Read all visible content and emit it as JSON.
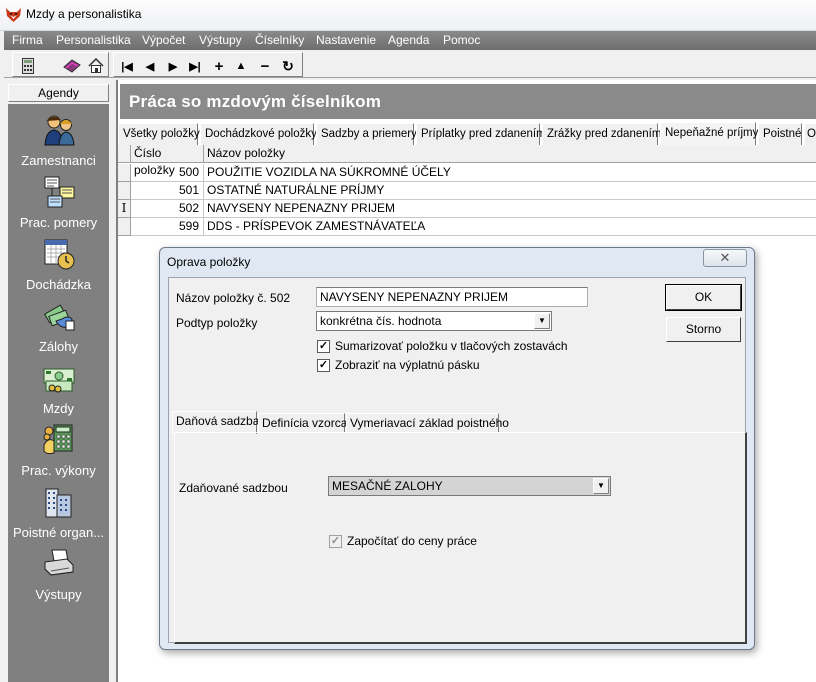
{
  "window": {
    "title": "Mzdy a personalistika",
    "icon": "fox-app-icon"
  },
  "menu": [
    "Firma",
    "Personalistika",
    "Výpočet",
    "Výstupy",
    "Číselníky",
    "Nastavenie",
    "Agenda",
    "Pomoc"
  ],
  "toolbar": {
    "icons": [
      "calculator-icon",
      "book-icon",
      "home-icon",
      "first-record-icon",
      "previous-record-icon",
      "next-record-icon",
      "last-record-icon",
      "add-record-icon",
      "up-icon",
      "delete-record-icon",
      "refresh-icon"
    ]
  },
  "agendy": {
    "header": "Agendy",
    "items": [
      {
        "label": "Zamestnanci",
        "icon": "employees-icon"
      },
      {
        "label": "Prac. pomery",
        "icon": "work-relations-icon"
      },
      {
        "label": "Dochádzka",
        "icon": "attendance-icon"
      },
      {
        "label": "Zálohy",
        "icon": "advances-icon"
      },
      {
        "label": "Mzdy",
        "icon": "wages-icon"
      },
      {
        "label": "Prac. výkony",
        "icon": "work-output-icon"
      },
      {
        "label": "Poistné organ...",
        "icon": "insurance-org-icon"
      },
      {
        "label": "Výstupy",
        "icon": "printer-icon"
      }
    ]
  },
  "page": {
    "title": "Práca so mzdovým číselníkom",
    "tabs": [
      "Všetky položky",
      "Dochádzkové položky",
      "Sadzby a priemery",
      "Príplatky pred zdanením",
      "Zrážky pred zdanením",
      "Nepeňažné príjmy",
      "Poistné",
      "O"
    ],
    "active_tab": "Nepeňažné príjmy",
    "table": {
      "columns": [
        "Číslo položky",
        "Názov položky"
      ],
      "rows": [
        {
          "indicator": "",
          "number": "500",
          "name": "POUŽITIE VOZIDLA NA SÚKROMNÉ ÚČELY"
        },
        {
          "indicator": "",
          "number": "501",
          "name": "OSTATNÉ NATURÁLNE PRÍJMY"
        },
        {
          "indicator": "I",
          "number": "502",
          "name": "NAVYSENY NEPENAZNY PRIJEM"
        },
        {
          "indicator": "",
          "number": "599",
          "name": "DDS - PRÍSPEVOK ZAMESTNÁVATEĽA"
        }
      ]
    }
  },
  "dialog": {
    "title": "Oprava položky",
    "close_symbol": "✕",
    "name_label": "Názov položky č.  502",
    "name_value": "NAVYSENY NEPENAZNY PRIJEM",
    "subtype_label": "Podtyp položky",
    "subtype_value": "konkrétna čís. hodnota",
    "sum_checkbox": {
      "label": "Sumarizovať položku v tlačových zostavách",
      "checked": true
    },
    "slip_checkbox": {
      "label": "Zobraziť na výplatnú pásku",
      "checked": true
    },
    "ok_label": "OK",
    "cancel_label": "Storno",
    "tabs": [
      "Daňová sadzba",
      "Definícia vzorca",
      "Vymeriavací základ poistného"
    ],
    "active_tab": "Daňová sadzba",
    "tax_label": "Zdaňované sadzbou",
    "tax_value": "MESAČNÉ ZALOHY",
    "labor_checkbox": {
      "label": "Započítať do ceny práce",
      "checked": true,
      "disabled": true
    },
    "check_mark": "✓"
  }
}
